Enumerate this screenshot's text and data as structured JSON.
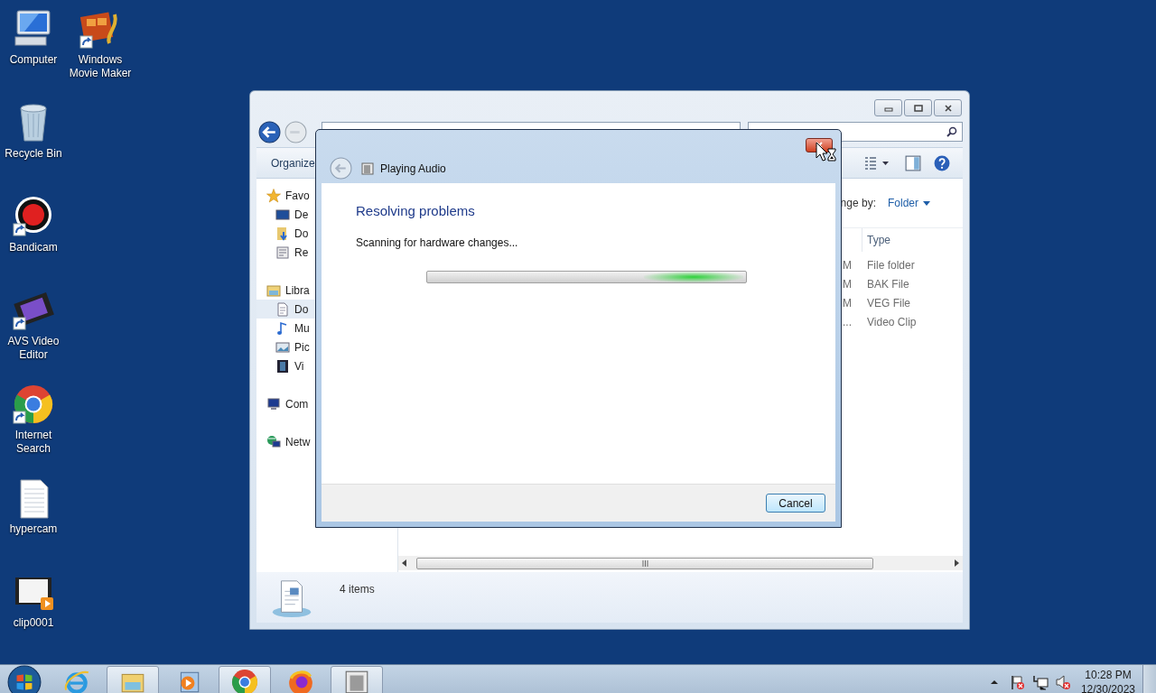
{
  "desktop_icons": [
    {
      "label": "Computer",
      "kind": "computer",
      "shortcut": false
    },
    {
      "label": "Windows Movie Maker",
      "kind": "moviemaker",
      "shortcut": true
    },
    {
      "label": "Recycle Bin",
      "kind": "recyclebin",
      "shortcut": false
    },
    {
      "label": "Bandicam",
      "kind": "bandicam",
      "shortcut": true
    },
    {
      "label": "AVS Video Editor",
      "kind": "avs",
      "shortcut": true
    },
    {
      "label": "Internet Search",
      "kind": "chrome",
      "shortcut": true
    },
    {
      "label": "hypercam",
      "kind": "textfile",
      "shortcut": false
    },
    {
      "label": "clip0001",
      "kind": "clip",
      "shortcut": false
    }
  ],
  "explorer": {
    "toolbar": {
      "organize": "Organize"
    },
    "nav_pane": [
      {
        "label": "Favo",
        "kind": "star",
        "selected": false,
        "children": [
          {
            "label": "De",
            "kind": "desktop",
            "selected": false
          },
          {
            "label": "Do",
            "kind": "download",
            "selected": false
          },
          {
            "label": "Re",
            "kind": "recent",
            "selected": false
          }
        ]
      },
      {
        "label": "Libra",
        "kind": "library",
        "selected": false,
        "children": [
          {
            "label": "Do",
            "kind": "document",
            "selected": true
          },
          {
            "label": "Mu",
            "kind": "music",
            "selected": false
          },
          {
            "label": "Pic",
            "kind": "picture",
            "selected": false
          },
          {
            "label": "Vi",
            "kind": "video",
            "selected": false
          }
        ]
      },
      {
        "label": "Com",
        "kind": "computer",
        "selected": false
      },
      {
        "label": "Netw",
        "kind": "network",
        "selected": false
      }
    ],
    "arrange_label": "nge by:",
    "arrange_value": "Folder",
    "columns": [
      "Type"
    ],
    "rows": [
      {
        "column_1": "M",
        "type": "File folder"
      },
      {
        "column_1": "M",
        "type": "BAK File"
      },
      {
        "column_1": "M",
        "type": "VEG File"
      },
      {
        "column_1": "...",
        "type": "Video Clip"
      }
    ],
    "status": "4 items"
  },
  "dialog": {
    "title": "Playing Audio",
    "heading": "Resolving problems",
    "message": "Scanning for hardware changes...",
    "progress": {
      "kind": "marquee"
    },
    "button": "Cancel"
  },
  "taskbar": {
    "items": [
      {
        "kind": "ie",
        "open": false
      },
      {
        "kind": "explorer",
        "open": true
      },
      {
        "kind": "mediaplayer",
        "open": false
      },
      {
        "kind": "chrome",
        "open": true
      },
      {
        "kind": "firefox",
        "open": false
      },
      {
        "kind": "app",
        "open": true
      }
    ],
    "clock": {
      "time": "10:28 PM",
      "date": "12/30/2023"
    }
  }
}
